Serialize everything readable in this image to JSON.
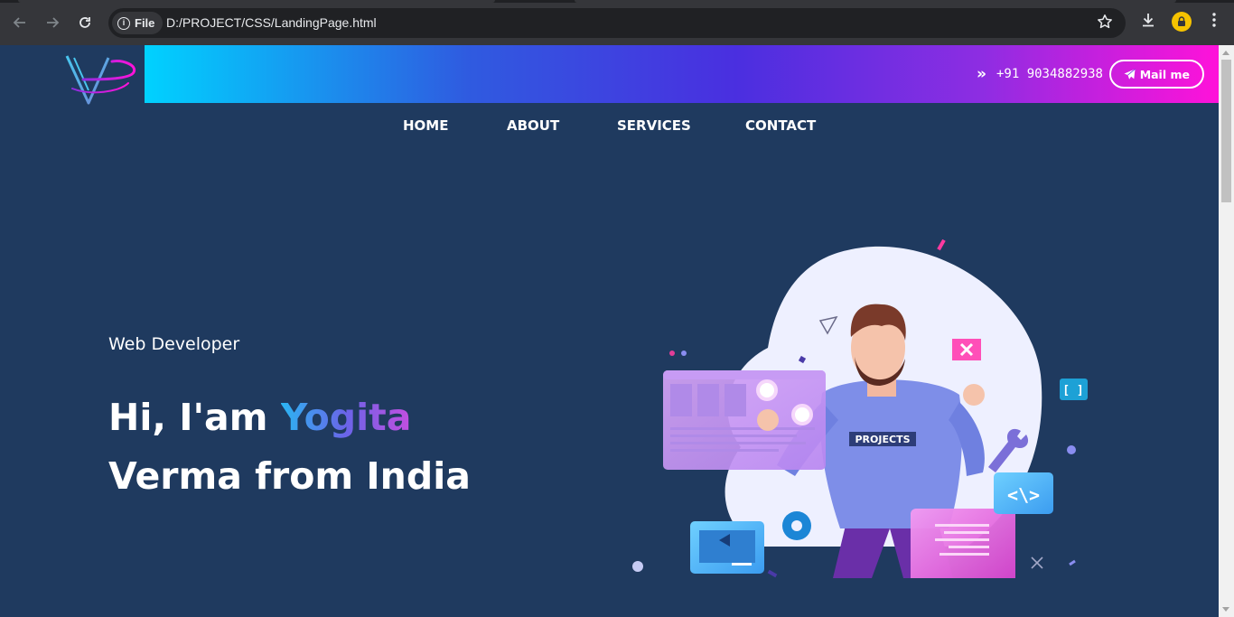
{
  "browser": {
    "site_chip_label": "File",
    "url": "D:/PROJECT/CSS/LandingPage.html",
    "icons": [
      "back-icon",
      "forward-icon",
      "reload-icon",
      "info-icon",
      "star-icon",
      "download-icon",
      "profile-icon",
      "menu-kebab-icon"
    ]
  },
  "header": {
    "phone": "+91 9034882938",
    "mail_button": "Mail me",
    "gradient_colors": [
      "#00d2ff",
      "#4a2fe0",
      "#8e2de2",
      "#ff12d9"
    ]
  },
  "nav": {
    "items": [
      {
        "label": "HOME"
      },
      {
        "label": "ABOUT"
      },
      {
        "label": "SERVICES"
      },
      {
        "label": "CONTACT"
      }
    ]
  },
  "hero": {
    "subtitle": "Web Developer",
    "greeting": "Hi, I'am ",
    "name": "Yogita",
    "line2": "Verma from India",
    "illustration_label": "PROJECTS"
  },
  "colors": {
    "page_bg": "#1f3a5f",
    "chrome_bg": "#35363a"
  }
}
